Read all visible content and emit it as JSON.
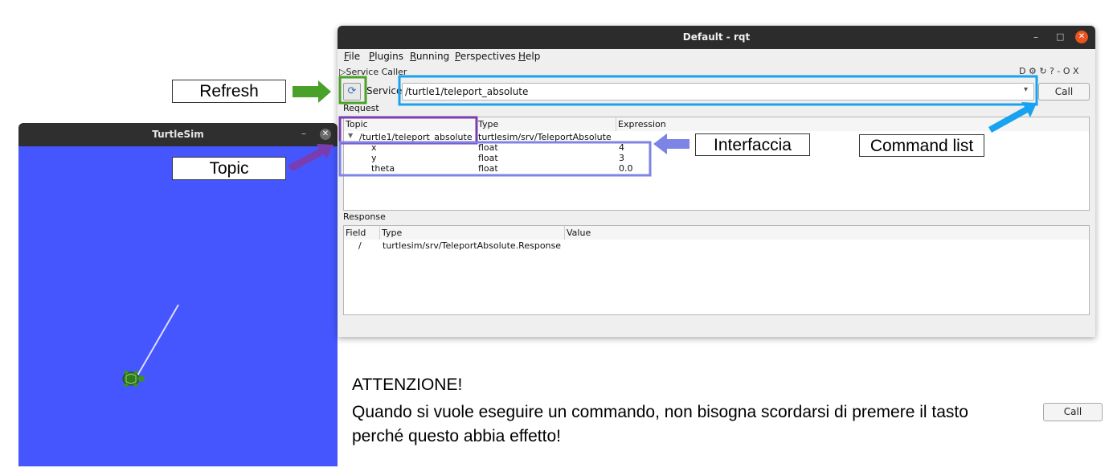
{
  "turtlesim": {
    "title": "TurtleSim",
    "minimize": "–",
    "close": "✕",
    "background_color": "#4556ff",
    "turtle_icon": "turtle-icon"
  },
  "rqt": {
    "title": "Default - rqt",
    "window_controls": {
      "minimize": "–",
      "maximize": "□",
      "close": "✕"
    },
    "menu": [
      "File",
      "Plugins",
      "Running",
      "Perspectives",
      "Help"
    ],
    "plugin_title": "▷Service Caller",
    "plugin_controls": "D ⚙ ↻ ? - O X",
    "refresh_icon": "refresh-icon",
    "service_label": "Service",
    "service_value": "/turtle1/teleport_absolute",
    "call_label": "Call",
    "request_label": "Request",
    "request_table": {
      "headers": [
        "Topic",
        "Type",
        "Expression"
      ],
      "root_row": {
        "topic": "/turtle1/teleport_absolute",
        "type": "turtlesim/srv/TeleportAbsolute"
      },
      "rows": [
        {
          "name": "x",
          "type": "float",
          "expression": "4"
        },
        {
          "name": "y",
          "type": "float",
          "expression": "3"
        },
        {
          "name": "theta",
          "type": "float",
          "expression": "0.0"
        }
      ]
    },
    "response_label": "Response",
    "response_table": {
      "headers": [
        "Field",
        "Type",
        "Value"
      ],
      "rows": [
        {
          "field": "/",
          "type": "turtlesim/srv/TeleportAbsolute.Response",
          "value": ""
        }
      ]
    }
  },
  "annotations": {
    "refresh": "Refresh",
    "topic": "Topic",
    "interfaccia": "Interfaccia",
    "command_list": "Command list",
    "colors": {
      "refresh": "#4aa12a",
      "topic": "#7a3db0",
      "interfaccia": "#7e84e6",
      "command_list": "#19a2f0"
    }
  },
  "note": {
    "title": "ATTENZIONE!",
    "line1": "Quando si vuole eseguire un commando, non bisogna scordarsi di premere il tasto",
    "line2": "perché questo abbia effetto!",
    "button_label": "Call"
  }
}
